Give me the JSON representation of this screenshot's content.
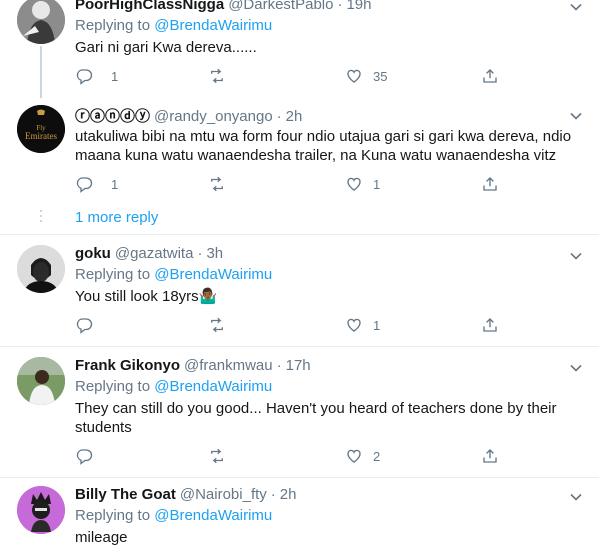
{
  "tweets": [
    {
      "name": "PoorHighClassNigga",
      "handle": "@DarkestPablo",
      "time": "19h",
      "replying_label": "Replying to ",
      "replying_to": "@BrendaWairimu",
      "text": "Gari ni gari Kwa dereva......",
      "replies": "1",
      "retweets": "",
      "likes": "35"
    },
    {
      "name": "ⓡⓐⓝⓓⓨ",
      "handle": "@randy_onyango",
      "time": "2h",
      "avatar_text_1": "Fly",
      "avatar_text_2": "Emirates",
      "text": "utakuliwa bibi na mtu wa form four ndio utajua gari si gari kwa dereva, ndio maana kuna watu wanaendesha trailer, na Kuna watu wanaendesha vitz",
      "replies": "1",
      "retweets": "",
      "likes": "1"
    },
    {
      "name": "goku",
      "handle": "@gazatwita",
      "time": "3h",
      "replying_label": "Replying to ",
      "replying_to": "@BrendaWairimu",
      "text": "You still look 18yrs🤷🏾‍♂️",
      "replies": "",
      "retweets": "",
      "likes": "1"
    },
    {
      "name": "Frank Gikonyo",
      "handle": "@frankmwau",
      "time": "17h",
      "replying_label": "Replying to ",
      "replying_to": "@BrendaWairimu",
      "text": "They can still do you good... Haven't you heard of teachers done by their students",
      "replies": "",
      "retweets": "",
      "likes": "2"
    },
    {
      "name": "Billy The Goat",
      "handle": "@Nairobi_fty",
      "time": "2h",
      "replying_label": "Replying to ",
      "replying_to": "@BrendaWairimu",
      "text": "mileage"
    }
  ],
  "more_reply": "1 more reply",
  "separator": "·",
  "colors": {
    "accent": "#1da1f2",
    "muted": "#657786",
    "divider": "#e6ecf0",
    "thread_line": "#ccd6dd"
  },
  "icons": {
    "reply": "reply-icon",
    "retweet": "retweet-icon",
    "like": "heart-icon",
    "share": "share-icon",
    "menu": "chevron-down-icon"
  }
}
